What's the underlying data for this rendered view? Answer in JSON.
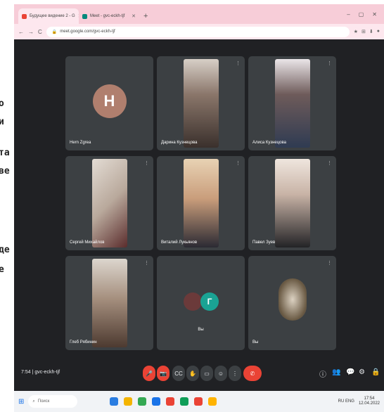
{
  "document_fragments": [
    "о",
    "и",
    "та",
    "ве",
    "де",
    "е"
  ],
  "browser": {
    "tabs": [
      {
        "label": "Будущее видение 2 - G",
        "active": true
      },
      {
        "label": "Meet - gvc-eckh-tjf",
        "active": false
      }
    ],
    "new_tab": "+",
    "window_controls": {
      "minimize": "–",
      "maximize": "▢",
      "close": "✕"
    },
    "address": "meet.google.com/gvc-eckh-tjf",
    "ext_icons": [
      "★",
      "⊞",
      "⬇",
      "●"
    ]
  },
  "meeting": {
    "participants": [
      {
        "name": "Hern Zgrea",
        "avatar_letter": "H",
        "avatar_color": "#b07f6e",
        "mic_icon": "",
        "cam_color": ""
      },
      {
        "name": "Дарина Кузнецова",
        "avatar_letter": "",
        "mic_icon": "⋮",
        "cam_color": "#9c8a7c"
      },
      {
        "name": "Алиса Кузнецова",
        "avatar_letter": "",
        "mic_icon": "⋮",
        "cam_color": "#c9c2c6"
      },
      {
        "name": "Сергей Михайлов",
        "avatar_letter": "",
        "mic_icon": "⋮",
        "cam_color": "#c7b9ad"
      },
      {
        "name": "Виталий Лукьянов",
        "avatar_letter": "",
        "mic_icon": "⋮",
        "cam_color": "#d7b498"
      },
      {
        "name": "Павел Зуев",
        "avatar_letter": "",
        "mic_icon": "⋮",
        "cam_color": "#cbbfb7"
      },
      {
        "name": "Глеб Рябинин",
        "avatar_letter": "",
        "mic_icon": "⋮",
        "cam_color": "#a59384"
      },
      {
        "name": "Вы",
        "avatar_letter": "",
        "mic_icon": "",
        "cam_color": ""
      },
      {
        "name": "Вы",
        "avatar_letter": "",
        "mic_icon": "⋮",
        "cam_color": "#55524e"
      }
    ],
    "shared_avatars": [
      {
        "letter": "",
        "color": "#6b3a3a"
      },
      {
        "letter": "Г",
        "color": "#1aa394"
      }
    ],
    "meeting_info": "7:54 | gvc-eckh-tjf",
    "controls": {
      "mic": "🎤",
      "cam": "📷",
      "captions": "CC",
      "raise_hand": "✋",
      "present": "▭",
      "reactions": "☺",
      "more": "⋮",
      "leave": "✆"
    },
    "right_controls": [
      "ⓘ",
      "👥",
      "💬",
      "⚙",
      "🔒"
    ]
  },
  "taskbar": {
    "search_placeholder": "Поиск",
    "search_icon": "⌕",
    "start_icon": "⊞",
    "app_colors": [
      "#2a7de1",
      "#f4b400",
      "#34a853",
      "#1a73e8",
      "#ea4335",
      "#0f9d58",
      "#ea4335",
      "#ffb300"
    ],
    "tray_text": "RU  ENG",
    "time": "17:54",
    "date": "12.04.2022"
  }
}
